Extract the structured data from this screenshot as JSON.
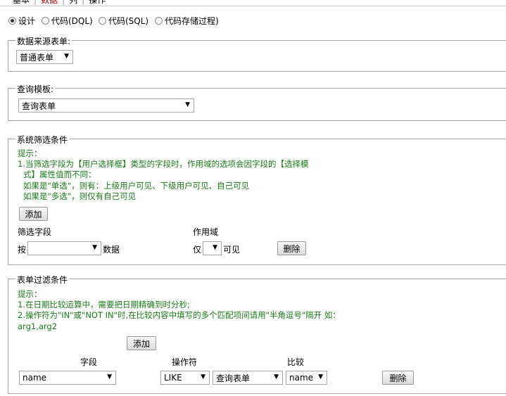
{
  "tabs": [
    "基本",
    "数据",
    "列",
    "操作"
  ],
  "modes": [
    {
      "label": "设计",
      "selected": true
    },
    {
      "label": "代码(DQL)",
      "selected": false
    },
    {
      "label": "代码(SQL)",
      "selected": false
    },
    {
      "label": "代码存储过程)",
      "selected": false
    }
  ],
  "datasource": {
    "legend": "数据来源表单:",
    "value": "普通表单"
  },
  "template": {
    "legend": "查询模板:",
    "value": "查询表单"
  },
  "sysfilter": {
    "legend": "系统筛选条件",
    "hint_title": "提示：",
    "hint_line1": "1.当筛选字段为【用户选择框】类型的字段时，作用域的选项会因字段的【选择模",
    "hint_line2": "式】属性值而不同：",
    "hint_line3": "如果是\"单选\"，则有：上级用户可见、下级用户可见、自己可见",
    "hint_line4": "如果是\"多选\"，则仅有自己可见",
    "add_label": "添加",
    "col_field": "筛选字段",
    "col_scope": "作用域",
    "prefix": "按",
    "field_value": "",
    "suffix": "数据",
    "scope_prefix": "仅",
    "scope_value": "",
    "scope_suffix": "可见",
    "delete_label": "删除"
  },
  "formfilter": {
    "legend": "表单过滤条件",
    "hint_title": "提示：",
    "hint_line1": "1.在日期比较运算中，需要把日期精确到时分秒;",
    "hint_line2": "2.操作符为\"IN\"或\"NOT IN\"时,在比较内容中填写的多个匹配项间请用\"半角逗号\"隔开 如：",
    "hint_line3": "arg1,arg2",
    "add_label": "添加",
    "col_field": "字段",
    "col_op": "操作符",
    "col_cmp": "比较",
    "field_value": "name",
    "op_value": "LIKE",
    "cmp_form_value": "查询表单",
    "cmp_field_value": "name",
    "delete_label": "删除"
  },
  "colors": {
    "hint": "#1a7a1a",
    "active_tab": "#c00000"
  }
}
